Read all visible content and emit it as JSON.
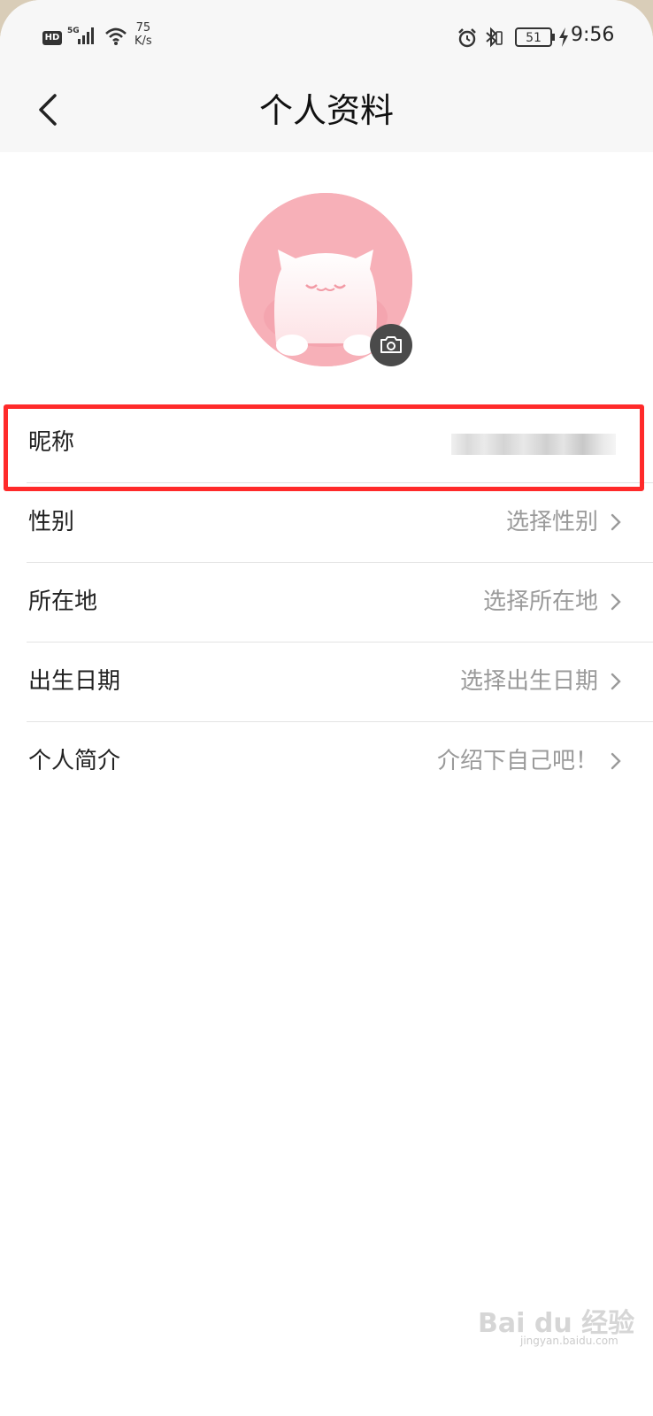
{
  "status_bar": {
    "hd": "HD",
    "network": "5G",
    "speed_value": "75",
    "speed_unit": "K/s",
    "battery": "51",
    "time": "9:56",
    "icons": [
      "signal-icon",
      "wifi-icon",
      "alarm-icon",
      "bluetooth-icon",
      "battery-icon",
      "charging-icon"
    ]
  },
  "header": {
    "title": "个人资料",
    "back_icon": "chevron-left-icon"
  },
  "avatar": {
    "camera_icon": "camera-icon",
    "bg_color": "#f7b0b8"
  },
  "rows": [
    {
      "label": "昵称",
      "value": ""
    },
    {
      "label": "性别",
      "value": "选择性别"
    },
    {
      "label": "所在地",
      "value": "选择所在地"
    },
    {
      "label": "出生日期",
      "value": "选择出生日期"
    },
    {
      "label": "个人简介",
      "value": "介绍下自己吧！"
    }
  ],
  "highlight_color": "#ff2a2a",
  "watermark": {
    "text": "Bai du 经验",
    "sub": "jingyan.baidu.com"
  }
}
